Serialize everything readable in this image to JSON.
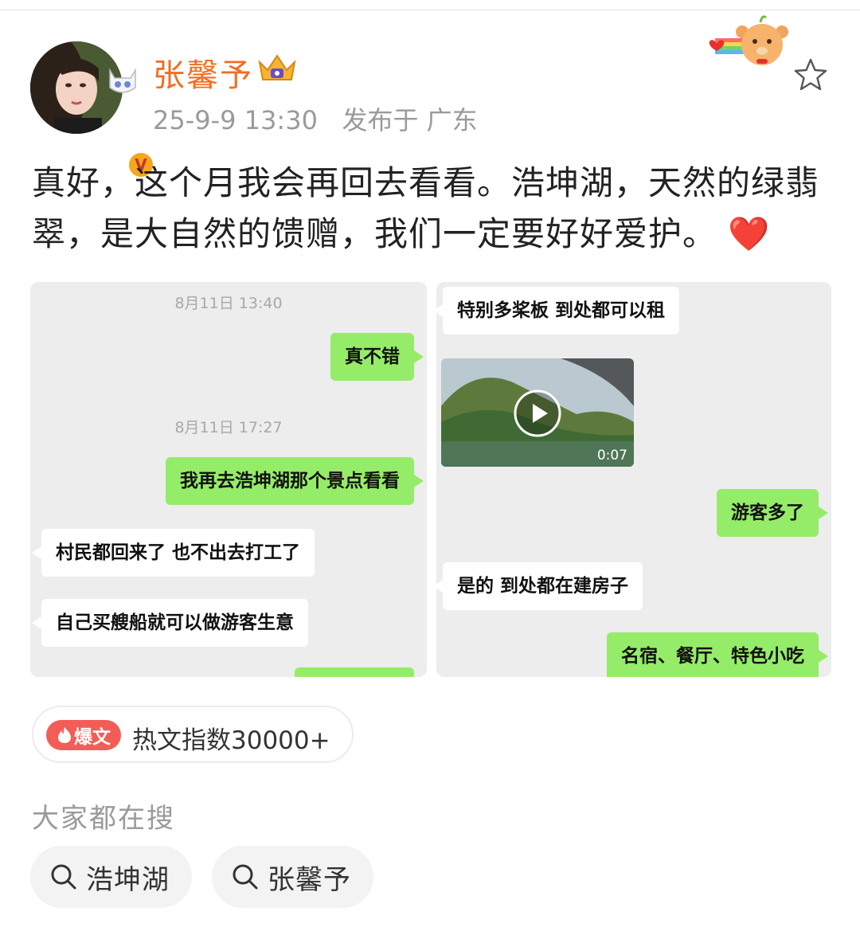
{
  "post": {
    "user_name": "张馨予",
    "timestamp": "25-9-9 13:30",
    "location": "发布于 广东",
    "text": "真好，这个月我会再回去看看。浩坤湖，天然的绿翡翠，是大自然的馈赠，我们一定要好好爱护。",
    "emoji": "❤️",
    "verified_badge": "V",
    "avatar_icon": "avatar-portrait",
    "crown_icon": "crown-icon",
    "star_icon": "star-outline-icon"
  },
  "chat_left": {
    "messages": [
      {
        "type": "timestamp",
        "text": "8月11日 13:40"
      },
      {
        "type": "sent",
        "text": "真不错"
      },
      {
        "type": "timestamp",
        "text": "8月11日 17:27"
      },
      {
        "type": "sent",
        "text": "我再去浩坤湖那个景点看看"
      },
      {
        "type": "received",
        "text": "村民都回来了 也不出去打工了"
      },
      {
        "type": "received",
        "text": "自己买艘船就可以做游客生意"
      }
    ]
  },
  "chat_right": {
    "messages": [
      {
        "type": "received",
        "text": "特别多桨板 到处都可以租"
      },
      {
        "type": "video",
        "duration": "0:07"
      },
      {
        "type": "sent",
        "text": "游客多了"
      },
      {
        "type": "received",
        "text": "是的 到处都在建房子"
      },
      {
        "type": "sent",
        "text": "名宿、餐厅、特色小吃"
      }
    ]
  },
  "hot": {
    "tag": "爆文",
    "text": "热文指数30000+"
  },
  "search": {
    "title": "大家都在搜",
    "chips": [
      "浩坤湖",
      "张馨予"
    ]
  },
  "colors": {
    "name_orange": "#f26d21",
    "wechat_green": "#95ec69",
    "hot_red": "#f35d57",
    "chat_bg": "#ededed"
  }
}
